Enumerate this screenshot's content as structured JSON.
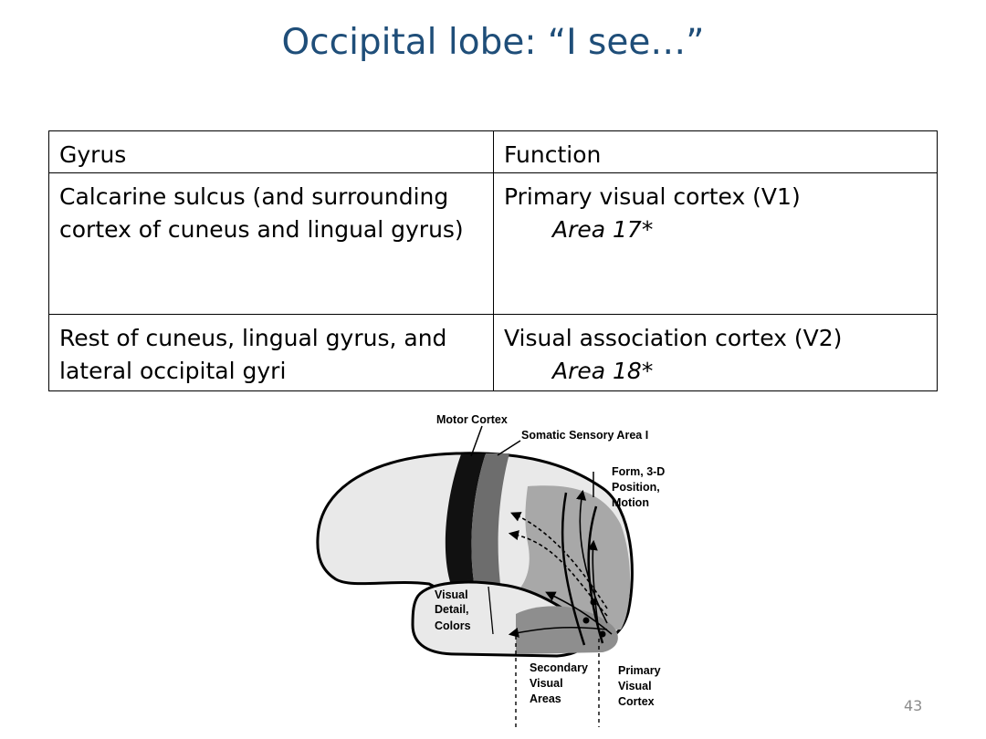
{
  "title": "Occipital lobe: “I see…”",
  "table": {
    "headers": [
      "Gyrus",
      "Function"
    ],
    "rows": [
      {
        "gyrus": "Calcarine sulcus (and surrounding cortex of cuneus and lingual gyrus)",
        "function": "Primary visual cortex (V1)",
        "area": "Area 17*"
      },
      {
        "gyrus": "Rest of cuneus, lingual gyrus, and lateral occipital gyri",
        "function": "Visual association cortex (V2)",
        "area": "Area 18*"
      }
    ]
  },
  "figure": {
    "labels": {
      "motor_cortex": "Motor Cortex",
      "somatic_sensory": "Somatic Sensory Area I",
      "form_line1": "Form, 3-D",
      "form_line2": "Position,",
      "form_line3": "Motion",
      "visual_line1": "Visual",
      "visual_line2": "Detail,",
      "visual_line3": "Colors",
      "secondary_line1": "Secondary",
      "secondary_line2": "Visual",
      "secondary_line3": "Areas",
      "primary_line1": "Primary",
      "primary_line2": "Visual",
      "primary_line3": "Cortex"
    }
  },
  "page_number": "43"
}
